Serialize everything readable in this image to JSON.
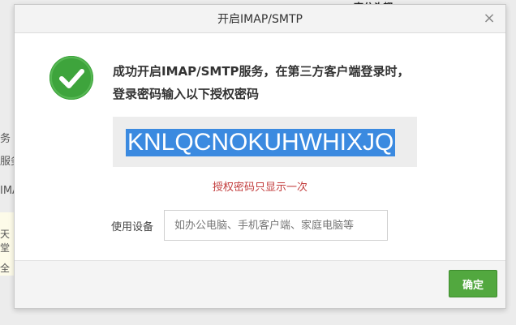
{
  "background": {
    "top_fragment": "南分头都 ",
    "left_fragments": [
      "务",
      "服务",
      "IMA",
      "天堂",
      "全"
    ]
  },
  "dialog": {
    "title": "开启IMAP/SMTP",
    "close_glyph": "×",
    "success_message": "成功开启IMAP/SMTP服务，在第三方客户端登录时，登录密码输入以下授权密码",
    "auth_code": "KNLQCNOKUHWHIXJQ",
    "once_note": "授权密码只显示一次",
    "device": {
      "label": "使用设备",
      "placeholder": "如办公电脑、手机客户端、家庭电脑等",
      "value": ""
    },
    "confirm_label": "确定"
  },
  "colors": {
    "success_green": "#3ea43c",
    "highlight_blue": "#3b8ae0",
    "warning_red": "#c23b3b",
    "button_green": "#52a83f"
  },
  "icons": {
    "success": "check-circle-icon",
    "close": "close-icon"
  }
}
